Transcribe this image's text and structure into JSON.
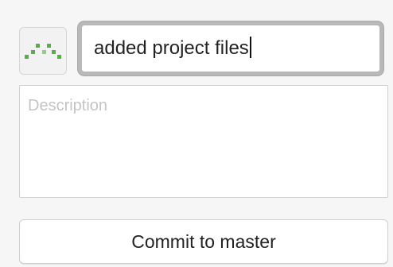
{
  "commit": {
    "avatar_icon": "identicon",
    "avatar_color": "#55b144",
    "summary_value": "added project files",
    "description_placeholder": "Description",
    "button_label": "Commit to master"
  }
}
